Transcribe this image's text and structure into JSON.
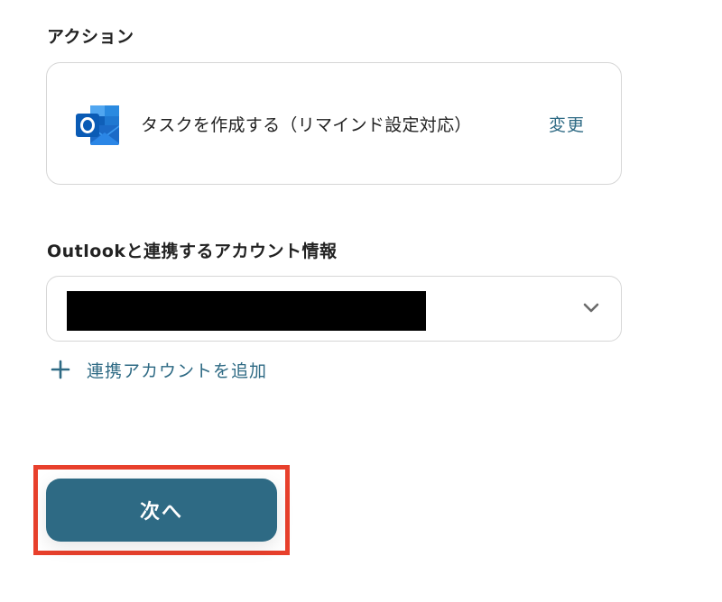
{
  "action_section": {
    "label": "アクション",
    "app_icon": "outlook-icon",
    "action_title": "タスクを作成する（リマインド設定対応）",
    "change_label": "変更"
  },
  "account_section": {
    "label": "Outlookと連携するアカウント情報",
    "selected_value": "",
    "dropdown_icon": "chevron-down-icon",
    "add_account_icon": "plus-icon",
    "add_account_label": "連携アカウントを追加"
  },
  "footer": {
    "next_label": "次へ"
  },
  "colors": {
    "accent": "#2e6a84",
    "highlight": "#e8402c",
    "outlook_blue": "#0a64c4",
    "border": "#d6d6d6"
  }
}
